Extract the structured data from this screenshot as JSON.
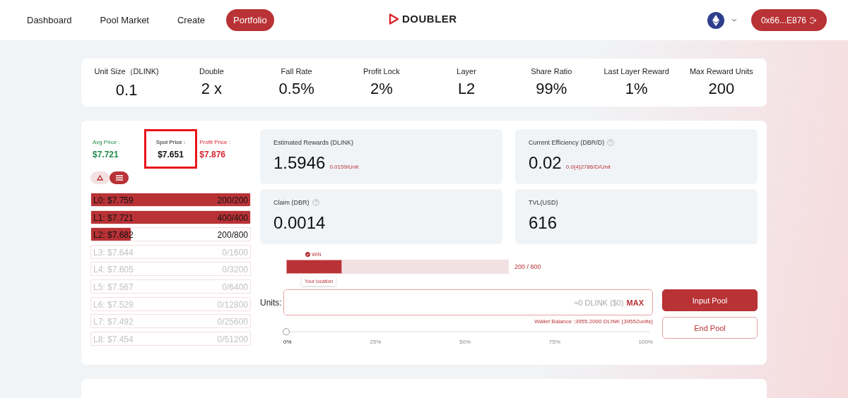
{
  "nav": {
    "items": [
      {
        "label": "Dashboard",
        "selected": false
      },
      {
        "label": "Pool Market",
        "selected": false
      },
      {
        "label": "Create",
        "selected": false
      },
      {
        "label": "Portfolio",
        "selected": true
      }
    ],
    "logo": "DOUBLER",
    "wallet": "0x66...E876"
  },
  "stats": [
    {
      "label": "Unit Size（DLINK)",
      "value": "0.1"
    },
    {
      "label": "Double",
      "value": "2 x"
    },
    {
      "label": "Fall Rate",
      "value": "0.5%"
    },
    {
      "label": "Profit Lock",
      "value": "2%"
    },
    {
      "label": "Layer",
      "value": "L2"
    },
    {
      "label": "Share Ratio",
      "value": "99%"
    },
    {
      "label": "Last Layer Reward",
      "value": "1%"
    },
    {
      "label": "Max Reward Units",
      "value": "200"
    }
  ],
  "prices": [
    {
      "label": "Avg Price :",
      "value": "$7.721",
      "kind": "avg",
      "highlighted": false
    },
    {
      "label": "Spot Price :",
      "value": "$7.651",
      "kind": "spot",
      "highlighted": true
    },
    {
      "label": "Profit Price :",
      "value": "$7.876",
      "kind": "profit",
      "highlighted": false
    }
  ],
  "view_toggle": [
    {
      "kind": "triangle",
      "selected": false
    },
    {
      "kind": "list",
      "selected": true
    }
  ],
  "layers": [
    {
      "label": "L0: $7.759",
      "count": "200/200",
      "level": 1,
      "active": true
    },
    {
      "label": "L1: $7.721",
      "count": "400/400",
      "level": 1,
      "active": true
    },
    {
      "label": "L2: $7.682",
      "count": "200/800",
      "level": 0.25,
      "active": true
    },
    {
      "label": "L3: $7.644",
      "count": "0/1600",
      "active": false
    },
    {
      "label": "L4: $7.605",
      "count": "0/3200",
      "active": false
    },
    {
      "label": "L5: $7.567",
      "count": "0/6400",
      "active": false
    },
    {
      "label": "L6: $7.529",
      "count": "0/12800",
      "active": false
    },
    {
      "label": "L7: $7.492",
      "count": "0/25600",
      "active": false
    },
    {
      "label": "L8: $7.454",
      "count": "0/51200",
      "active": false
    }
  ],
  "cards": [
    {
      "label": "Estimated Rewards (DLINK)",
      "value": "1.5946",
      "sub": "0.0159/Unit",
      "help": false
    },
    {
      "label": "Current Efficiency (DBR/D)",
      "value": "0.02",
      "sub": "0.0{4}2786/D/Unit",
      "help": true
    },
    {
      "label": "Claim (DBR)",
      "value": "0.0014",
      "help": true
    },
    {
      "label": "TVL(USD)",
      "value": "616",
      "help": false
    }
  ],
  "layer_progress": {
    "win": "WIN",
    "level": 0.25,
    "reading": "200 / 800",
    "tooltip": "Your location"
  },
  "units": {
    "label": "Units:",
    "estimate": "≈0 DLINK ($0)",
    "max": "MAX",
    "wallet_balance": "Wallet Balance :3955.2000 DLINK (39552units)"
  },
  "slider": {
    "level": 0,
    "ticks": [
      "0%",
      "25%",
      "50%",
      "75%",
      "100%"
    ]
  },
  "buttons": [
    {
      "label": "Input Pool",
      "kind": "primary"
    },
    {
      "label": "End Pool",
      "kind": "secondary"
    }
  ]
}
